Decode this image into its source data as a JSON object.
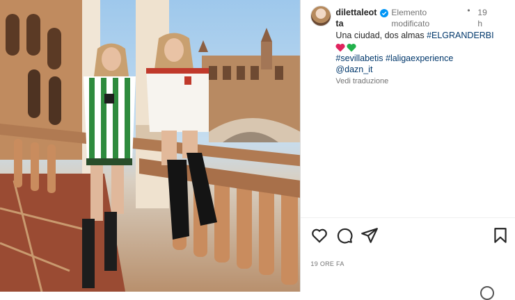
{
  "post": {
    "username": "dilettaleotta",
    "edited_label": "Elemento modificato",
    "time_ago": "19 h",
    "caption_line1_text": "Una ciudad, dos almas ",
    "caption_line1_hashtag": "#ELGRANDERBI",
    "hearts": [
      "red-heart-emoji",
      "green-heart-emoji"
    ],
    "hashtags_line": "#sevillabetis #laligaexperience",
    "mention": "@dazn_it",
    "see_translation": "Vedi traduzione",
    "timestamp": "19 ORE FA"
  },
  "icons": [
    "like-heart-icon",
    "comment-icon",
    "share-icon",
    "save-bookmark-icon",
    "verified-badge-icon"
  ],
  "colors": {
    "link": "#00376b",
    "verified": "#0095f6",
    "heart_red": "#e0245e",
    "heart_green": "#22b14c",
    "muted": "#737373"
  }
}
